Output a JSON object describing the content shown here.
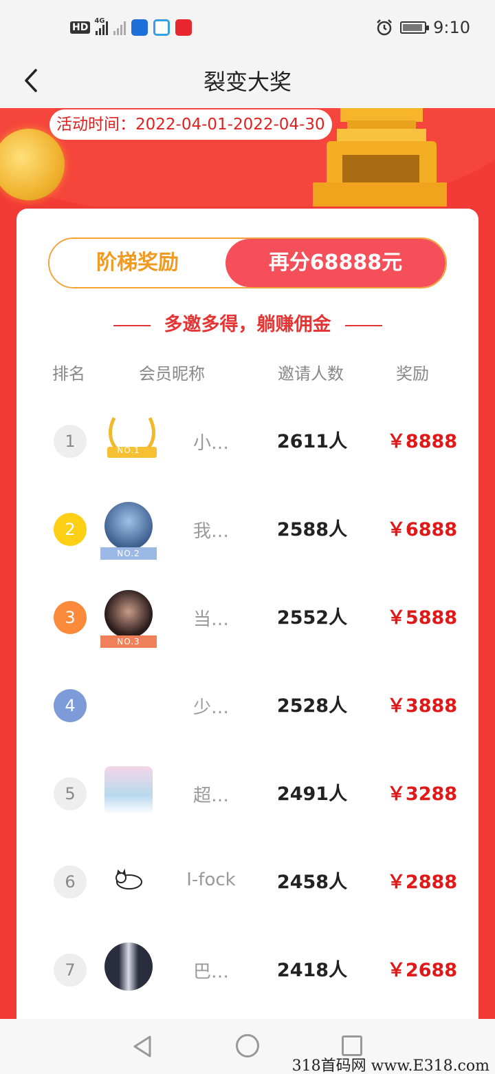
{
  "status_bar": {
    "hd": "HD",
    "network": "4G",
    "time": "9:10"
  },
  "header": {
    "title": "裂变大奖"
  },
  "banner": {
    "activity_time": "活动时间：2022-04-01-2022-04-30"
  },
  "tabs": [
    {
      "label": "阶梯奖励",
      "active": false
    },
    {
      "label": "再分68888元",
      "active": true
    }
  ],
  "slogan": "多邀多得，躺赚佣金",
  "table": {
    "headers": [
      "排名",
      "会员昵称",
      "邀请人数",
      "奖励"
    ],
    "rows": [
      {
        "rank": "1",
        "nickname": "小…",
        "invites": "2611人",
        "reward": "￥8888",
        "badge": "NO.1"
      },
      {
        "rank": "2",
        "nickname": "我…",
        "invites": "2588人",
        "reward": "￥6888",
        "badge": "NO.2"
      },
      {
        "rank": "3",
        "nickname": "当…",
        "invites": "2552人",
        "reward": "￥5888",
        "badge": "NO.3"
      },
      {
        "rank": "4",
        "nickname": "少…",
        "invites": "2528人",
        "reward": "￥3888"
      },
      {
        "rank": "5",
        "nickname": "超…",
        "invites": "2491人",
        "reward": "￥3288"
      },
      {
        "rank": "6",
        "nickname": "I-fock",
        "invites": "2458人",
        "reward": "￥2888"
      },
      {
        "rank": "7",
        "nickname": "巴…",
        "invites": "2418人",
        "reward": "￥2688"
      }
    ]
  },
  "watermark": "318首码网 www.E318.com",
  "colors": {
    "primary_red": "#f23b36",
    "accent_orange": "#f09a22",
    "reward_red": "#e01818"
  }
}
